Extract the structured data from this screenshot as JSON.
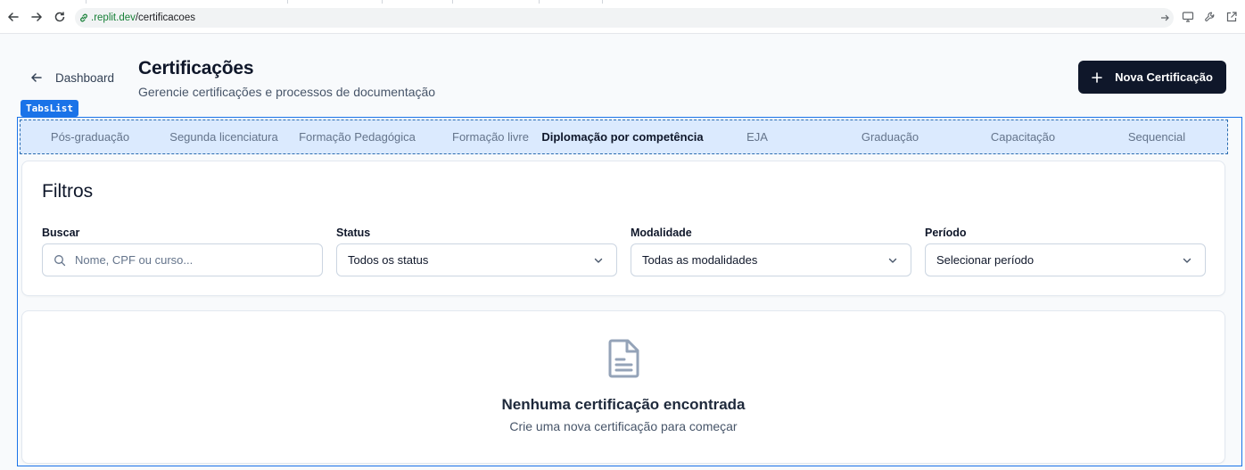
{
  "browser": {
    "url_domain": ".replit.dev",
    "url_path": "/certificacoes"
  },
  "header": {
    "back_label": "Dashboard",
    "title": "Certificações",
    "subtitle": "Gerencie certificações e processos de documentação",
    "new_button_label": "Nova Certificação"
  },
  "dev_overlay": {
    "tag": "TabsList"
  },
  "tabs": [
    {
      "label": "Pós-graduação",
      "active": false
    },
    {
      "label": "Segunda licenciatura",
      "active": false
    },
    {
      "label": "Formação Pedagógica",
      "active": false
    },
    {
      "label": "Formação livre",
      "active": false
    },
    {
      "label": "Diplomação por competência",
      "active": true
    },
    {
      "label": "EJA",
      "active": false
    },
    {
      "label": "Graduação",
      "active": false
    },
    {
      "label": "Capacitação",
      "active": false
    },
    {
      "label": "Sequencial",
      "active": false
    }
  ],
  "filters": {
    "title": "Filtros",
    "search": {
      "label": "Buscar",
      "placeholder": "Nome, CPF ou curso...",
      "value": ""
    },
    "status": {
      "label": "Status",
      "value": "Todos os status"
    },
    "modality": {
      "label": "Modalidade",
      "value": "Todas as modalidades"
    },
    "period": {
      "label": "Período",
      "value": "Selecionar período"
    }
  },
  "empty_state": {
    "icon": "document-icon",
    "title": "Nenhuma certificação encontrada",
    "subtitle": "Crie uma nova certificação para começar"
  },
  "colors": {
    "primary": "#0f172a",
    "tabs_bg": "#dbeafe",
    "dev_overlay": "#1a73e8",
    "url_domain": "#188038"
  }
}
